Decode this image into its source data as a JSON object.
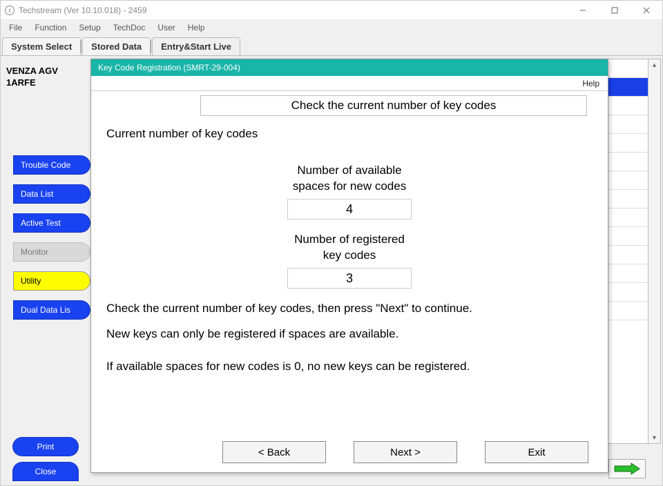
{
  "window": {
    "title": "Techstream (Ver 10.10.018) - 2459"
  },
  "menu": {
    "file": "File",
    "function": "Function",
    "setup": "Setup",
    "techdoc": "TechDoc",
    "user": "User",
    "help": "Help"
  },
  "tabs": {
    "system_select": "System Select",
    "stored_data": "Stored Data",
    "entry_start_live": "Entry&Start Live"
  },
  "vehicle": {
    "line1": "VENZA AGV",
    "line2": "1ARFE"
  },
  "sidebar": {
    "trouble_codes": "Trouble Code",
    "data_list": "Data List",
    "active_test": "Active Test",
    "monitor": "Monitor",
    "utility": "Utility",
    "dual_data": "Dual Data Lis",
    "print": "Print",
    "close": "Close"
  },
  "dialog": {
    "title": "Key Code Registration (SMRT-29-004)",
    "help": "Help",
    "heading": "Check the current number of key codes",
    "sub": "Current number of key codes",
    "avail_label1": "Number of available",
    "avail_label2": "spaces for new codes",
    "avail_value": "4",
    "reg_label1": "Number of registered",
    "reg_label2": "key codes",
    "reg_value": "3",
    "para1": "Check the current number of key codes, then press \"Next\" to continue.",
    "para2": "New keys can only be registered if spaces are available.",
    "para3": "If available spaces for new codes is 0, no new keys can be registered.",
    "back": "< Back",
    "next": "Next >",
    "exit": "Exit"
  }
}
